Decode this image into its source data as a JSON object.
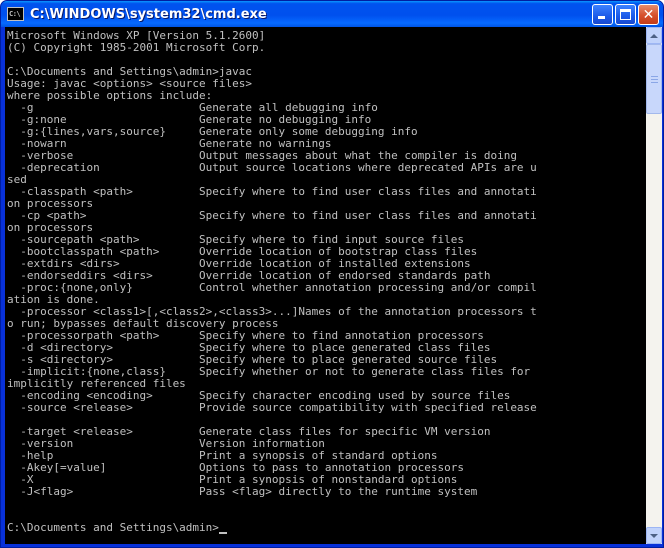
{
  "window": {
    "title": "C:\\WINDOWS\\system32\\cmd.exe",
    "icon_label": "C:\\"
  },
  "console": {
    "lines": [
      "Microsoft Windows XP [Version 5.1.2600]",
      "(C) Copyright 1985-2001 Microsoft Corp.",
      "",
      "C:\\Documents and Settings\\admin>javac",
      "Usage: javac <options> <source files>",
      "where possible options include:",
      "  -g                         Generate all debugging info",
      "  -g:none                    Generate no debugging info",
      "  -g:{lines,vars,source}     Generate only some debugging info",
      "  -nowarn                    Generate no warnings",
      "  -verbose                   Output messages about what the compiler is doing",
      "  -deprecation               Output source locations where deprecated APIs are u",
      "sed",
      "  -classpath <path>          Specify where to find user class files and annotati",
      "on processors",
      "  -cp <path>                 Specify where to find user class files and annotati",
      "on processors",
      "  -sourcepath <path>         Specify where to find input source files",
      "  -bootclasspath <path>      Override location of bootstrap class files",
      "  -extdirs <dirs>            Override location of installed extensions",
      "  -endorseddirs <dirs>       Override location of endorsed standards path",
      "  -proc:{none,only}          Control whether annotation processing and/or compil",
      "ation is done.",
      "  -processor <class1>[,<class2>,<class3>...]Names of the annotation processors t",
      "o run; bypasses default discovery process",
      "  -processorpath <path>      Specify where to find annotation processors",
      "  -d <directory>             Specify where to place generated class files",
      "  -s <directory>             Specify where to place generated source files",
      "  -implicit:{none,class}     Specify whether or not to generate class files for",
      "implicitly referenced files",
      "  -encoding <encoding>       Specify character encoding used by source files",
      "  -source <release>          Provide source compatibility with specified release",
      "",
      "  -target <release>          Generate class files for specific VM version",
      "  -version                   Version information",
      "  -help                      Print a synopsis of standard options",
      "  -Akey[=value]              Options to pass to annotation processors",
      "  -X                         Print a synopsis of nonstandard options",
      "  -J<flag>                   Pass <flag> directly to the runtime system",
      "",
      "",
      "C:\\Documents and Settings\\admin>"
    ]
  },
  "colors": {
    "console_bg": "#000000",
    "console_fg": "#c0c0c0",
    "titlebar": "#0054e3"
  },
  "icons": {
    "minimize": "minimize-icon",
    "maximize": "maximize-icon",
    "close": "close-icon",
    "scroll_up": "arrow-up-icon",
    "scroll_down": "arrow-down-icon"
  }
}
